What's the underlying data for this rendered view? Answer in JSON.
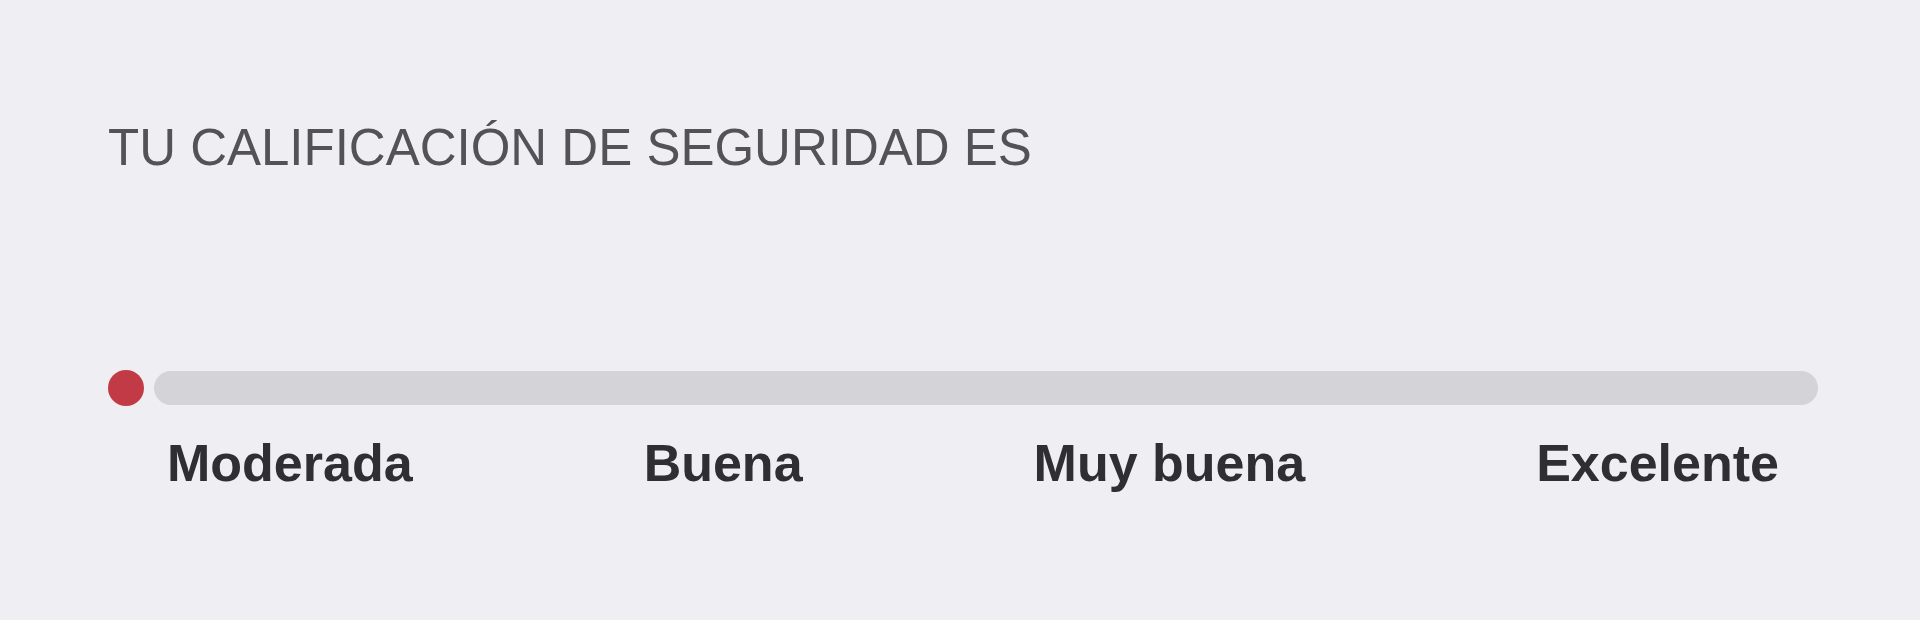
{
  "title": "TU CALIFICACIÓN DE SEGURIDAD ES",
  "rating": {
    "labels": [
      "Moderada",
      "Buena",
      "Muy buena",
      "Excelente"
    ]
  }
}
